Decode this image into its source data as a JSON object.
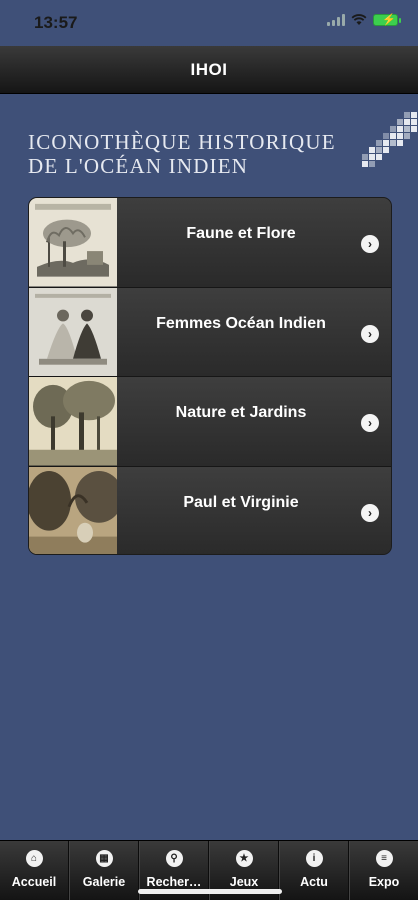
{
  "status": {
    "time": "13:57"
  },
  "nav": {
    "title": "IHOI"
  },
  "logo": {
    "line1": "ICONOTHÈQUE HISTORIQUE",
    "line2": "DE L'OCÉAN INDIEN"
  },
  "menu": {
    "items": [
      {
        "label": "Faune et Flore",
        "thumb": "engraving-landscape"
      },
      {
        "label": "Femmes Océan Indien",
        "thumb": "engraving-women"
      },
      {
        "label": "Nature et Jardins",
        "thumb": "engraving-garden"
      },
      {
        "label": "Paul et Virginie",
        "thumb": "engraving-scene"
      }
    ]
  },
  "tabs": [
    {
      "label": "Accueil",
      "icon": "home-icon"
    },
    {
      "label": "Galerie",
      "icon": "grid-icon"
    },
    {
      "label": "Recher…",
      "icon": "search-icon"
    },
    {
      "label": "Jeux",
      "icon": "star-icon"
    },
    {
      "label": "Actu",
      "icon": "info-icon"
    },
    {
      "label": "Expo",
      "icon": "list-icon"
    }
  ],
  "colors": {
    "background": "#3f5078",
    "bar": "#222222",
    "battery": "#3ccf4e"
  }
}
